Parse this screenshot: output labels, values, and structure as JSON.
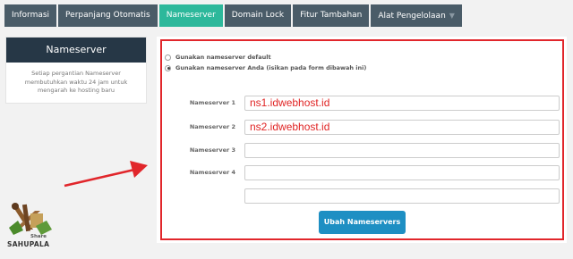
{
  "tabs": [
    {
      "label": "Informasi",
      "active": false
    },
    {
      "label": "Perpanjang Otomatis",
      "active": false
    },
    {
      "label": "Nameserver",
      "active": true
    },
    {
      "label": "Domain Lock",
      "active": false
    },
    {
      "label": "Fitur Tambahan",
      "active": false
    },
    {
      "label": "Alat Pengelolaan",
      "active": false,
      "icon": "chevron-down-icon"
    }
  ],
  "sidebar": {
    "title": "Nameserver",
    "info": "Setiap pergantian Nameserver membutuhkan waktu 24 jam untuk mengarah ke hosting baru"
  },
  "form": {
    "options": [
      {
        "label": "Gunakan nameserver default",
        "checked": false
      },
      {
        "label": "Gunakan nameserver Anda (isikan pada form dibawah ini)",
        "checked": true
      }
    ],
    "nameservers": [
      {
        "label": "Nameserver 1",
        "value": "ns1.idwebhost.id"
      },
      {
        "label": "Nameserver 2",
        "value": "ns2.idwebhost.id"
      },
      {
        "label": "Nameserver 3",
        "value": ""
      },
      {
        "label": "Nameserver 4",
        "value": ""
      },
      {
        "label": "",
        "value": ""
      }
    ],
    "submit_label": "Ubah Nameservers"
  },
  "watermark": {
    "share": "Share",
    "brand": "SAHUPALA"
  },
  "colors": {
    "tab_bg": "#4a5c68",
    "tab_active": "#2db89b",
    "sidebar_header": "#263746",
    "button": "#1e8fc3",
    "highlight_red": "#e1262b"
  }
}
